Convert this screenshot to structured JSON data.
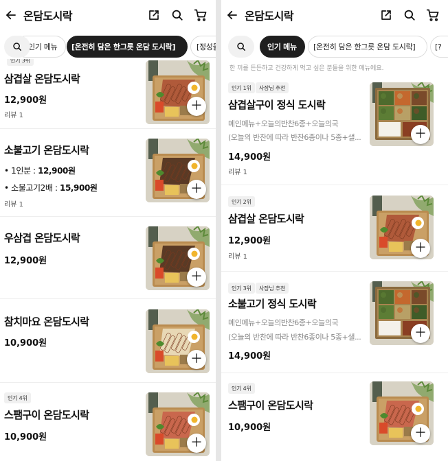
{
  "header": {
    "title": "온담도시락"
  },
  "left": {
    "tabs": [
      "인기 메뉴",
      "[온전히 담은 한그릇 온담 도시락]",
      "[정성들"
    ],
    "top_cut_badge": "인기 3위",
    "items": [
      {
        "name": "삼겹살 온담도시락",
        "price": "12,900원",
        "review": "리뷰 1"
      },
      {
        "name": "소불고기 온담도시락",
        "options": [
          {
            "label": "• 1인분 : ",
            "price": "12,900원"
          },
          {
            "label": "• 소불고기2배 : ",
            "price": "15,900원"
          }
        ],
        "review": "리뷰 1"
      },
      {
        "name": "우삼겹 온담도시락",
        "price": "12,900원"
      },
      {
        "name": "참치마요 온담도시락",
        "price": "10,900원"
      },
      {
        "badge": "인기 4위",
        "name": "스팸구이 온담도시락",
        "price": "10,900원"
      }
    ]
  },
  "right": {
    "tabs": [
      "인기 메뉴",
      "[온전히 담은 한그릇 온담 도시락]",
      "[?"
    ],
    "top_cut_text": "한 끼를 든든하고 건강하게 먹고 싶은 분들을 위한 메뉴에요.",
    "items": [
      {
        "badges": [
          "인기 1위",
          "사장님 추천"
        ],
        "name": "삼겹살구이 정식 도시락",
        "desc": [
          "메인메뉴+오늘의반찬6종+오늘의국",
          "(오늘의 반찬에 따라 반찬6종이나 5종+샐..."
        ],
        "price": "14,900원",
        "review": "리뷰 1"
      },
      {
        "badges": [
          "인기 2위"
        ],
        "name": "삼겹살 온담도시락",
        "price": "12,900원",
        "review": "리뷰 1"
      },
      {
        "badges": [
          "인기 3위",
          "사장님 추천"
        ],
        "name": "소불고기 정식 도시락",
        "desc": [
          "메인메뉴+오늘의반찬6종+오늘의국",
          "(오늘의 반찬에 따라 반찬6종이나 5종+샐..."
        ],
        "price": "14,900원"
      },
      {
        "badges": [
          "인기 4위"
        ],
        "name": "스팸구이 온담도시락",
        "price": "10,900원"
      }
    ]
  },
  "icons": {
    "back": "arrow-left-icon",
    "share": "share-icon",
    "search": "search-icon",
    "cart": "cart-icon",
    "add": "plus-icon"
  },
  "colors": {
    "active_tab": "#1f1f1f",
    "badge_bg": "#f0f0f0"
  }
}
